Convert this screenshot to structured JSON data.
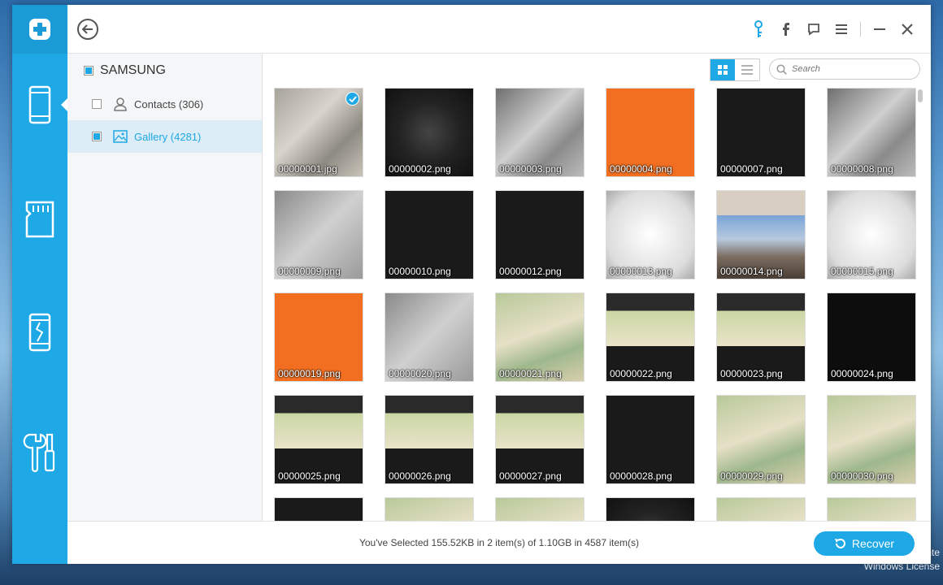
{
  "rail": {
    "items": [
      {
        "name": "rail-phone",
        "icon": "phone-icon"
      },
      {
        "name": "rail-sdcard",
        "icon": "sdcard-icon"
      },
      {
        "name": "rail-broken",
        "icon": "broken-phone-icon"
      },
      {
        "name": "rail-tools",
        "icon": "tools-icon"
      }
    ]
  },
  "sidebar": {
    "device": "SAMSUNG",
    "items": [
      {
        "label": "Contacts (306)",
        "checked": false,
        "active": false,
        "icon": "person-icon"
      },
      {
        "label": "Gallery (4281)",
        "checked": true,
        "active": true,
        "icon": "image-icon"
      }
    ]
  },
  "search": {
    "placeholder": "Search"
  },
  "tiles": [
    {
      "file": "00000001.jpg",
      "style": "photo",
      "selected": true
    },
    {
      "file": "00000002.png",
      "style": "dark",
      "selected": false
    },
    {
      "file": "00000003.png",
      "style": "metal",
      "selected": false
    },
    {
      "file": "00000004.png",
      "style": "orange",
      "selected": false
    },
    {
      "file": "00000007.png",
      "style": "list",
      "selected": false
    },
    {
      "file": "00000008.png",
      "style": "metal",
      "selected": false
    },
    {
      "file": "00000009.png",
      "style": "gray",
      "selected": false
    },
    {
      "file": "00000010.png",
      "style": "list",
      "selected": false
    },
    {
      "file": "00000012.png",
      "style": "list",
      "selected": false
    },
    {
      "file": "00000013.png",
      "style": "white",
      "selected": false
    },
    {
      "file": "00000014.png",
      "style": "city",
      "selected": false
    },
    {
      "file": "00000015.png",
      "style": "white",
      "selected": false
    },
    {
      "file": "00000019.png",
      "style": "orange",
      "selected": false
    },
    {
      "file": "00000020.png",
      "style": "gray",
      "selected": false
    },
    {
      "file": "00000021.png",
      "style": "map",
      "selected": false
    },
    {
      "file": "00000022.png",
      "style": "mapdark",
      "selected": false
    },
    {
      "file": "00000023.png",
      "style": "mapdark",
      "selected": false
    },
    {
      "file": "00000024.png",
      "style": "text",
      "selected": false
    },
    {
      "file": "00000025.png",
      "style": "mapdark",
      "selected": false
    },
    {
      "file": "00000026.png",
      "style": "mapdark",
      "selected": false
    },
    {
      "file": "00000027.png",
      "style": "mapdark",
      "selected": false
    },
    {
      "file": "00000028.png",
      "style": "list",
      "selected": false
    },
    {
      "file": "00000029.png",
      "style": "map",
      "selected": false
    },
    {
      "file": "00000030.png",
      "style": "map",
      "selected": false
    },
    {
      "file": "",
      "style": "list",
      "selected": false
    },
    {
      "file": "",
      "style": "map",
      "selected": false
    },
    {
      "file": "",
      "style": "map",
      "selected": false
    },
    {
      "file": "",
      "style": "dark",
      "selected": false
    },
    {
      "file": "",
      "style": "map",
      "selected": false
    },
    {
      "file": "",
      "style": "map",
      "selected": false
    }
  ],
  "footer": {
    "status": "You've Selected 155.52KB in 2 item(s) of 1.10GB in 4587 item(s)",
    "recover_label": "Recover"
  },
  "desktop": {
    "watermark_line1": "nte",
    "watermark_line2": "Windows License"
  },
  "colors": {
    "accent": "#1ea8e6",
    "rail": "#1ea8e6",
    "selected_row": "#dcedf7"
  }
}
